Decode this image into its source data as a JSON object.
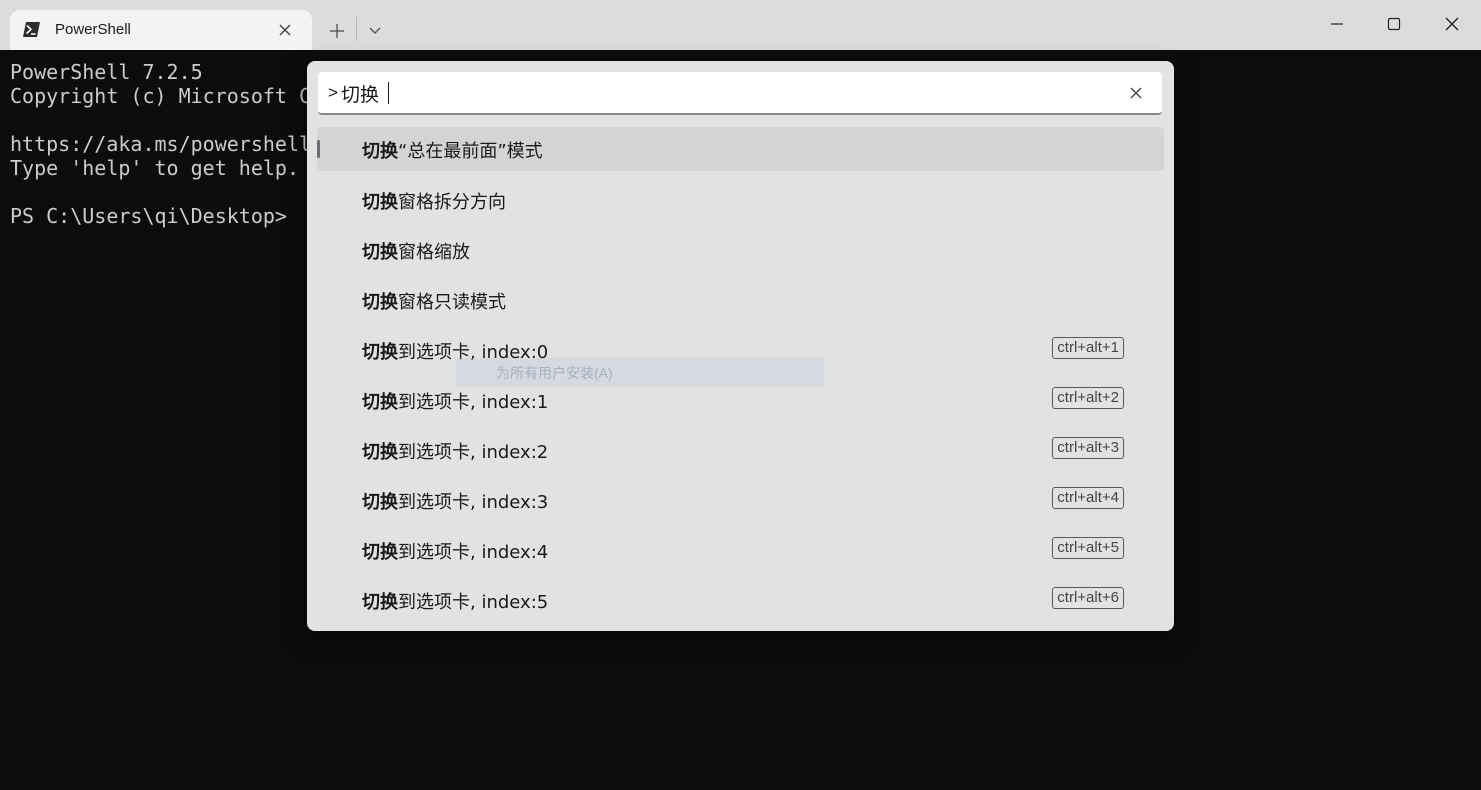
{
  "window": {
    "tab_title": "PowerShell",
    "minimize_label": "",
    "maximize_label": "",
    "close_label": ""
  },
  "terminal": {
    "lines": [
      "PowerShell 7.2.5",
      "Copyright (c) Microsoft C",
      "",
      "https://aka.ms/powershell",
      "Type 'help' to get help.",
      "",
      "PS C:\\Users\\qi\\Desktop>"
    ]
  },
  "palette": {
    "search_prefix": ">",
    "search_value": "切换",
    "items": [
      {
        "match": "切换",
        "rest": "“总在最前面”模式",
        "shortcut": ""
      },
      {
        "match": "切换",
        "rest": "窗格拆分方向",
        "shortcut": ""
      },
      {
        "match": "切换",
        "rest": "窗格缩放",
        "shortcut": ""
      },
      {
        "match": "切换",
        "rest": "窗格只读模式",
        "shortcut": ""
      },
      {
        "match": "切换",
        "rest": "到选项卡, index:0",
        "shortcut": "ctrl+alt+1"
      },
      {
        "match": "切换",
        "rest": "到选项卡, index:1",
        "shortcut": "ctrl+alt+2"
      },
      {
        "match": "切换",
        "rest": "到选项卡, index:2",
        "shortcut": "ctrl+alt+3"
      },
      {
        "match": "切换",
        "rest": "到选项卡, index:3",
        "shortcut": "ctrl+alt+4"
      },
      {
        "match": "切换",
        "rest": "到选项卡, index:4",
        "shortcut": "ctrl+alt+5"
      },
      {
        "match": "切换",
        "rest": "到选项卡, index:5",
        "shortcut": "ctrl+alt+6"
      }
    ]
  },
  "ghost": {
    "text": "为所有用户安装(A)"
  },
  "colors": {
    "titlebar": "#dcdcdc",
    "terminal_bg": "#0c0c0c",
    "terminal_fg": "#cccccc",
    "palette_bg": "#e2e2e2",
    "selected_bg": "#d4d4d4"
  },
  "icons": {
    "tab": "powershell-icon",
    "tab_close": "close-icon",
    "new_tab": "plus-icon",
    "dropdown": "chevron-down-icon",
    "minimize": "minimize-icon",
    "maximize": "maximize-icon",
    "close": "close-icon",
    "search_clear": "clear-icon"
  }
}
